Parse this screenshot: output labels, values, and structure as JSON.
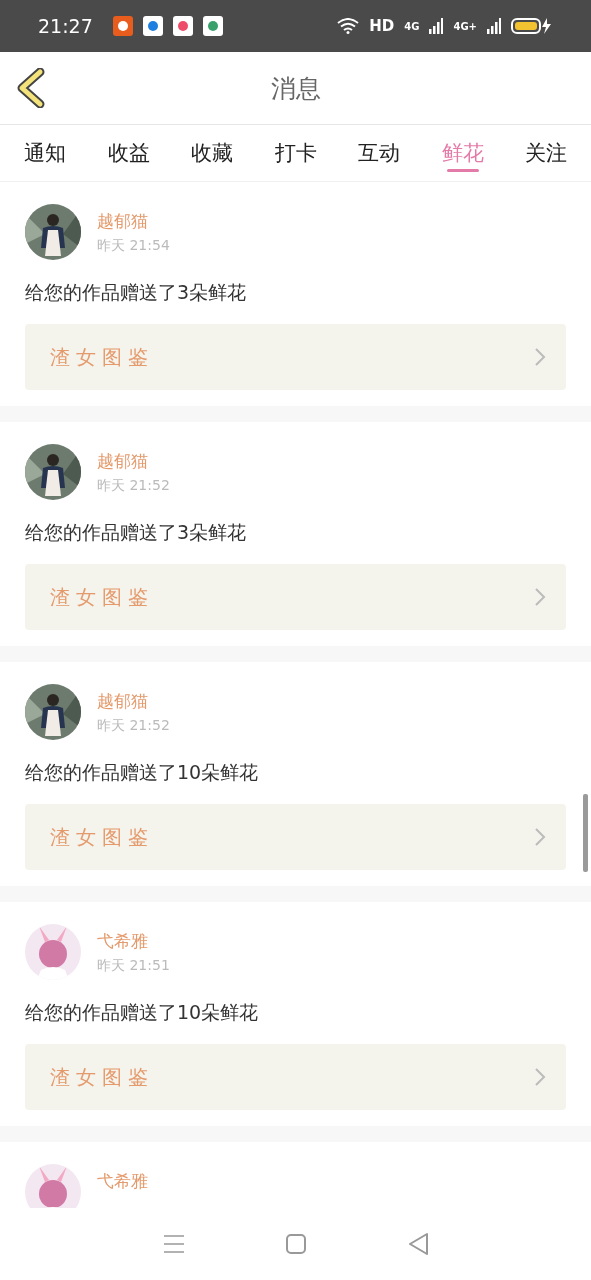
{
  "status_bar": {
    "time": "21:27",
    "hd": "HD",
    "networks": [
      "4G",
      "4G+"
    ]
  },
  "header": {
    "title": "消息"
  },
  "tabs": [
    {
      "label": "通知",
      "selected": false
    },
    {
      "label": "收益",
      "selected": false
    },
    {
      "label": "收藏",
      "selected": false
    },
    {
      "label": "打卡",
      "selected": false
    },
    {
      "label": "互动",
      "selected": false
    },
    {
      "label": "鲜花",
      "selected": true
    },
    {
      "label": "关注",
      "selected": false
    }
  ],
  "messages": [
    {
      "user": "越郁猫",
      "avatar": {
        "kind": "photo"
      },
      "time": "昨天 21:54",
      "text": "给您的作品赠送了3朵鲜花",
      "work": "渣女图鉴"
    },
    {
      "user": "越郁猫",
      "avatar": {
        "kind": "photo"
      },
      "time": "昨天 21:52",
      "text": "给您的作品赠送了3朵鲜花",
      "work": "渣女图鉴"
    },
    {
      "user": "越郁猫",
      "avatar": {
        "kind": "photo"
      },
      "time": "昨天 21:52",
      "text": "给您的作品赠送了10朵鲜花",
      "work": "渣女图鉴"
    },
    {
      "user": "弋希雅",
      "avatar": {
        "kind": "illustration"
      },
      "time": "昨天 21:51",
      "text": "给您的作品赠送了10朵鲜花",
      "work": "渣女图鉴"
    },
    {
      "user": "弋希雅",
      "avatar": {
        "kind": "illustration"
      }
    }
  ]
}
